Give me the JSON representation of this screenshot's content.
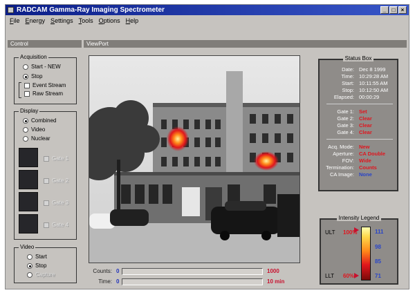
{
  "window": {
    "title": "RADCAM Gamma-Ray  Imaging Spectrometer",
    "buttons": {
      "minimize": "_",
      "maximize": "□",
      "close": "×"
    }
  },
  "menu": [
    "File",
    "Energy",
    "Settings",
    "Tools",
    "Options",
    "Help"
  ],
  "control_panel": {
    "header": "Control",
    "acquisition": {
      "title": "Acquisition",
      "start_new": "Start - NEW",
      "stop": "Stop",
      "event_stream": "Event Stream",
      "raw_stream": "Raw Stream"
    },
    "display": {
      "title": "Display",
      "combined": "Combined",
      "video": "Video",
      "nuclear": "Nuclear",
      "gates": [
        "Gate 1",
        "Gate 2",
        "Gate 3",
        "Gate 4"
      ]
    },
    "video": {
      "title": "Video",
      "start": "Start",
      "stop": "Stop",
      "capture": "Capture"
    }
  },
  "viewport": {
    "header": "ViewPort",
    "counts_label": "Counts:",
    "counts_value": "0",
    "counts_max": "1000",
    "time_label": "Time:",
    "time_value": "0",
    "time_max": "10 min"
  },
  "status_box": {
    "title": "Status Box",
    "rows": [
      {
        "key": "Date:",
        "value": "Dec 8 1999"
      },
      {
        "key": "Time:",
        "value": "10:29:28 AM"
      },
      {
        "key": "Start:",
        "value": "10:11:55 AM"
      },
      {
        "key": "Stop:",
        "value": "10:12:50 AM"
      },
      {
        "key": "Elapsed:",
        "value": "00:00:29"
      }
    ],
    "gates": [
      {
        "key": "Gate 1:",
        "value": "Set"
      },
      {
        "key": "Gate 2:",
        "value": "Clear"
      },
      {
        "key": "Gate 3:",
        "value": "Clear"
      },
      {
        "key": "Gate 4:",
        "value": "Clear"
      }
    ],
    "acq": [
      {
        "key": "Acq. Mode:",
        "value": "New"
      },
      {
        "key": "Aperture:",
        "value": "CA Double"
      },
      {
        "key": "FOV:",
        "value": "Wide"
      },
      {
        "key": "Termination:",
        "value": "Counts"
      },
      {
        "key": "CA Image:",
        "value": "None"
      }
    ]
  },
  "intensity_legend": {
    "title": "Intensity Legend",
    "ult": "ULT",
    "ult_pct": "100%",
    "llt": "LLT",
    "llt_pct": "60%",
    "ticks": [
      "111",
      "98",
      "85",
      "71"
    ]
  },
  "colors": {
    "title_bar": "#0b1e88",
    "panel_bg": "#c6c3bf",
    "status_red": "#e0151e",
    "status_blue": "#2844c8",
    "value_blue": "#2233bb"
  }
}
